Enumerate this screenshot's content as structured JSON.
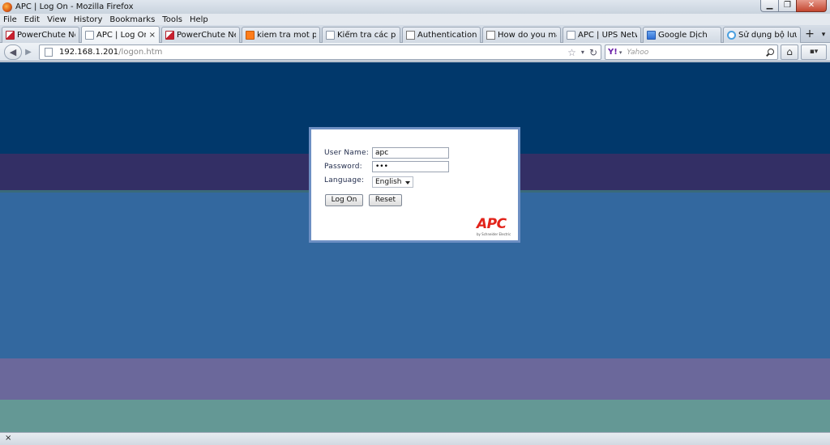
{
  "window": {
    "title": "APC | Log On - Mozilla Firefox",
    "buttons": {
      "minimize": "▁",
      "maximize": "❐",
      "close": "✕"
    }
  },
  "menu": [
    "File",
    "Edit",
    "View",
    "History",
    "Bookmarks",
    "Tools",
    "Help"
  ],
  "tabs": [
    {
      "label": "PowerChute Net...",
      "icon": "powerchute-icon",
      "active": false
    },
    {
      "label": "APC | Log On",
      "icon": "blank-page-icon",
      "active": true,
      "close": "×"
    },
    {
      "label": "PowerChute Net...",
      "icon": "powerchute-icon",
      "active": false
    },
    {
      "label": "kiem tra mot port...",
      "icon": "blogger-icon",
      "active": false
    },
    {
      "label": "Kiểm tra các port ...",
      "icon": "blank-page-icon",
      "active": false
    },
    {
      "label": "Authentication Fa...",
      "icon": "document-icon",
      "active": false
    },
    {
      "label": "How do you mak...",
      "icon": "document-icon",
      "active": false
    },
    {
      "label": "APC | UPS Networ...",
      "icon": "blank-page-icon",
      "active": false
    },
    {
      "label": "Google Dịch",
      "icon": "google-translate-icon",
      "active": false
    },
    {
      "label": "Sử dụng bộ lưu đi...",
      "icon": "loading-icon",
      "active": false
    }
  ],
  "tabstrip": {
    "new_tab": "+",
    "list_tabs": "▾"
  },
  "nav": {
    "back": "◀",
    "forward": "▶",
    "url_host": "192.168.1.201",
    "url_path": "/logon.htm",
    "bookmark_star": "☆",
    "url_dropdown": "▾",
    "reload": "↻",
    "search_engine": "Y!",
    "search_engine_dropdown": "▾",
    "search_placeholder": "Yahoo",
    "home": "⌂",
    "addon": "▪▾"
  },
  "login": {
    "user_label": "User Name:",
    "user_value": "apc",
    "password_label": "Password:",
    "password_value": "•••",
    "language_label": "Language:",
    "language_value": "English",
    "logon_button": "Log On",
    "reset_button": "Reset",
    "logo_text": "APC",
    "logo_sub": "by Schneider Electric"
  },
  "status": {
    "close": "×"
  },
  "colors": {
    "band_navy": "#01386b",
    "band_indigo": "#332f65",
    "band_blue": "#33689f",
    "band_purple": "#6b689b",
    "band_teal": "#649895",
    "dialog_border": "#6d8fc3",
    "logo_red": "#e2231a"
  }
}
